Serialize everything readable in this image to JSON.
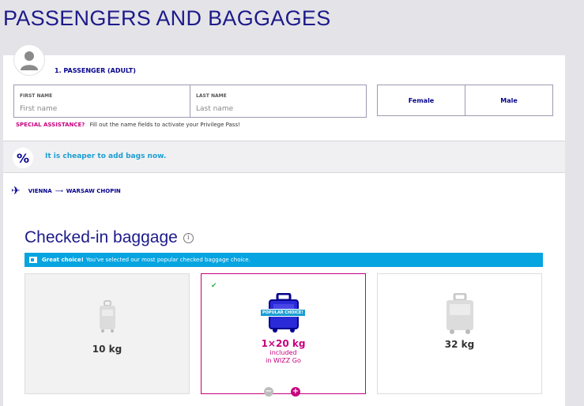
{
  "page": {
    "title": "PASSENGERS AND BAGGAGES"
  },
  "passenger": {
    "label": "1. PASSENGER (ADULT)",
    "first_name_label": "FIRST NAME",
    "first_name_placeholder": "First name",
    "last_name_label": "LAST NAME",
    "last_name_placeholder": "Last name",
    "gender_options": [
      "Female",
      "Male"
    ],
    "special_assistance_label": "SPECIAL ASSISTANCE?",
    "special_assistance_text": "Fill out the name fields to activate your Privilege Pass!"
  },
  "promo": {
    "icon": "percent-icon",
    "message": "It is cheaper to add bags now."
  },
  "route": {
    "from": "VIENNA",
    "to": "WARSAW CHOPIN"
  },
  "checked_in": {
    "title": "Checked-in baggage",
    "banner_bold": "Great choice!",
    "banner_text": "You've selected our most popular checked baggage choice.",
    "options": [
      {
        "weight": "10 kg"
      },
      {
        "weight": "1×20 kg",
        "sub1": "included",
        "sub2": "in WIZZ Go",
        "badge": "POPULAR CHOICE!",
        "selected": true
      },
      {
        "weight": "32 kg"
      }
    ],
    "stepper": {
      "minus": "−",
      "plus": "+"
    }
  }
}
